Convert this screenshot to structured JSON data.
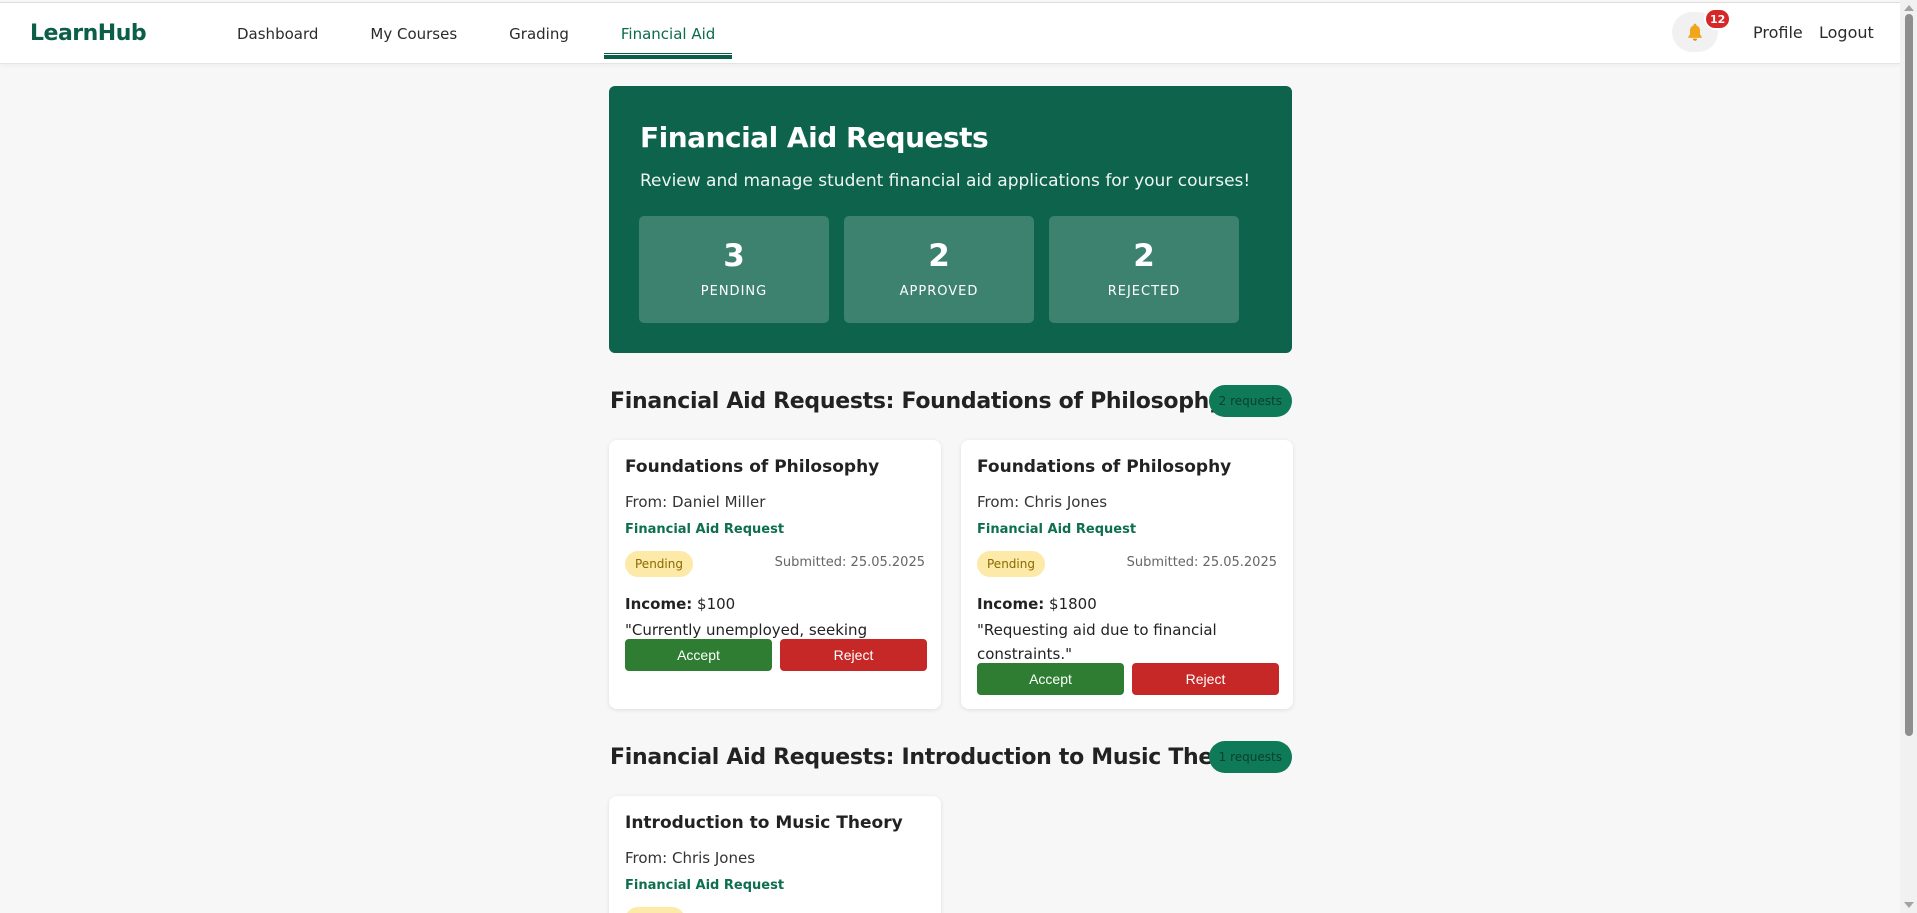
{
  "app": {
    "logo": "LearnHub"
  },
  "nav": {
    "items": [
      {
        "label": "Dashboard"
      },
      {
        "label": "My Courses"
      },
      {
        "label": "Grading"
      },
      {
        "label": "Financial Aid"
      }
    ],
    "active": "Financial Aid"
  },
  "header": {
    "notifications_icon": "bell-icon",
    "notification_count": "12",
    "profile_label": "Profile",
    "logout_label": "Logout"
  },
  "hero": {
    "title": "Financial Aid Requests",
    "subtitle": "Review and manage student financial aid applications for your courses!",
    "stats": [
      {
        "value": "3",
        "label": "PENDING"
      },
      {
        "value": "2",
        "label": "APPROVED"
      },
      {
        "value": "2",
        "label": "REJECTED"
      }
    ]
  },
  "sections": [
    {
      "title": "Financial Aid Requests: Foundations of Philosophy",
      "count_label": "2 requests",
      "cards": [
        {
          "course": "Foundations of Philosophy",
          "from": "From: Daniel Miller",
          "type": "Financial Aid Request",
          "status": "Pending",
          "submitted": "Submitted: 25.05.2025",
          "income_label": "Income:",
          "income_value": "$100",
          "reason": "\"Currently unemployed, seeking support.\"",
          "accept_label": "Accept",
          "reject_label": "Reject"
        },
        {
          "course": "Foundations of Philosophy",
          "from": "From: Chris Jones",
          "type": "Financial Aid Request",
          "status": "Pending",
          "submitted": "Submitted: 25.05.2025",
          "income_label": "Income:",
          "income_value": "$1800",
          "reason": "\"Requesting aid due to financial constraints.\"",
          "accept_label": "Accept",
          "reject_label": "Reject"
        }
      ]
    },
    {
      "title": "Financial Aid Requests: Introduction to Music Theory",
      "count_label": "1 requests",
      "cards": [
        {
          "course": "Introduction to Music Theory",
          "from": "From: Chris Jones",
          "type": "Financial Aid Request"
        }
      ]
    }
  ],
  "colors": {
    "brand": "#0d634b",
    "accept": "#2e7d32",
    "reject": "#c62828",
    "pending_bg": "#fde9a8"
  }
}
